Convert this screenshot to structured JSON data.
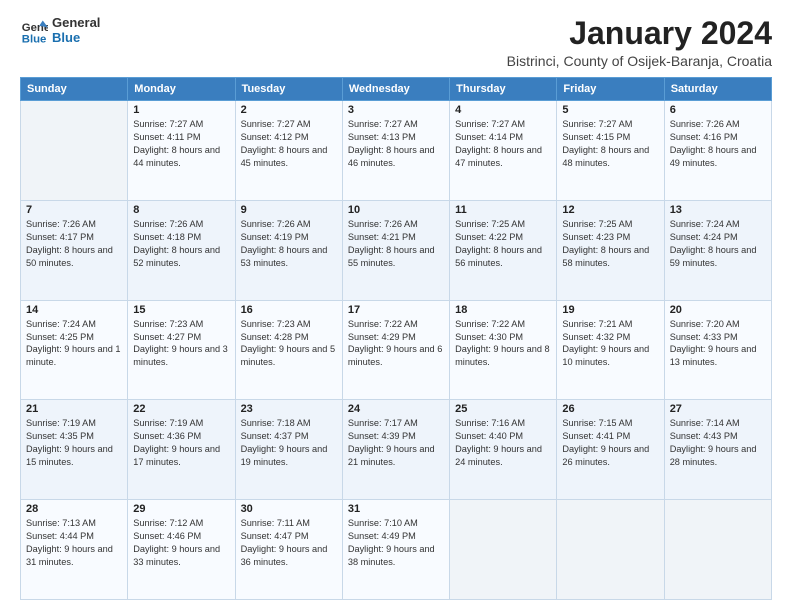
{
  "header": {
    "logo_line1": "General",
    "logo_line2": "Blue",
    "month": "January 2024",
    "location": "Bistrinci, County of Osijek-Baranja, Croatia"
  },
  "weekdays": [
    "Sunday",
    "Monday",
    "Tuesday",
    "Wednesday",
    "Thursday",
    "Friday",
    "Saturday"
  ],
  "weeks": [
    [
      {
        "day": "",
        "sunrise": "",
        "sunset": "",
        "daylight": ""
      },
      {
        "day": "1",
        "sunrise": "Sunrise: 7:27 AM",
        "sunset": "Sunset: 4:11 PM",
        "daylight": "Daylight: 8 hours and 44 minutes."
      },
      {
        "day": "2",
        "sunrise": "Sunrise: 7:27 AM",
        "sunset": "Sunset: 4:12 PM",
        "daylight": "Daylight: 8 hours and 45 minutes."
      },
      {
        "day": "3",
        "sunrise": "Sunrise: 7:27 AM",
        "sunset": "Sunset: 4:13 PM",
        "daylight": "Daylight: 8 hours and 46 minutes."
      },
      {
        "day": "4",
        "sunrise": "Sunrise: 7:27 AM",
        "sunset": "Sunset: 4:14 PM",
        "daylight": "Daylight: 8 hours and 47 minutes."
      },
      {
        "day": "5",
        "sunrise": "Sunrise: 7:27 AM",
        "sunset": "Sunset: 4:15 PM",
        "daylight": "Daylight: 8 hours and 48 minutes."
      },
      {
        "day": "6",
        "sunrise": "Sunrise: 7:26 AM",
        "sunset": "Sunset: 4:16 PM",
        "daylight": "Daylight: 8 hours and 49 minutes."
      }
    ],
    [
      {
        "day": "7",
        "sunrise": "Sunrise: 7:26 AM",
        "sunset": "Sunset: 4:17 PM",
        "daylight": "Daylight: 8 hours and 50 minutes."
      },
      {
        "day": "8",
        "sunrise": "Sunrise: 7:26 AM",
        "sunset": "Sunset: 4:18 PM",
        "daylight": "Daylight: 8 hours and 52 minutes."
      },
      {
        "day": "9",
        "sunrise": "Sunrise: 7:26 AM",
        "sunset": "Sunset: 4:19 PM",
        "daylight": "Daylight: 8 hours and 53 minutes."
      },
      {
        "day": "10",
        "sunrise": "Sunrise: 7:26 AM",
        "sunset": "Sunset: 4:21 PM",
        "daylight": "Daylight: 8 hours and 55 minutes."
      },
      {
        "day": "11",
        "sunrise": "Sunrise: 7:25 AM",
        "sunset": "Sunset: 4:22 PM",
        "daylight": "Daylight: 8 hours and 56 minutes."
      },
      {
        "day": "12",
        "sunrise": "Sunrise: 7:25 AM",
        "sunset": "Sunset: 4:23 PM",
        "daylight": "Daylight: 8 hours and 58 minutes."
      },
      {
        "day": "13",
        "sunrise": "Sunrise: 7:24 AM",
        "sunset": "Sunset: 4:24 PM",
        "daylight": "Daylight: 8 hours and 59 minutes."
      }
    ],
    [
      {
        "day": "14",
        "sunrise": "Sunrise: 7:24 AM",
        "sunset": "Sunset: 4:25 PM",
        "daylight": "Daylight: 9 hours and 1 minute."
      },
      {
        "day": "15",
        "sunrise": "Sunrise: 7:23 AM",
        "sunset": "Sunset: 4:27 PM",
        "daylight": "Daylight: 9 hours and 3 minutes."
      },
      {
        "day": "16",
        "sunrise": "Sunrise: 7:23 AM",
        "sunset": "Sunset: 4:28 PM",
        "daylight": "Daylight: 9 hours and 5 minutes."
      },
      {
        "day": "17",
        "sunrise": "Sunrise: 7:22 AM",
        "sunset": "Sunset: 4:29 PM",
        "daylight": "Daylight: 9 hours and 6 minutes."
      },
      {
        "day": "18",
        "sunrise": "Sunrise: 7:22 AM",
        "sunset": "Sunset: 4:30 PM",
        "daylight": "Daylight: 9 hours and 8 minutes."
      },
      {
        "day": "19",
        "sunrise": "Sunrise: 7:21 AM",
        "sunset": "Sunset: 4:32 PM",
        "daylight": "Daylight: 9 hours and 10 minutes."
      },
      {
        "day": "20",
        "sunrise": "Sunrise: 7:20 AM",
        "sunset": "Sunset: 4:33 PM",
        "daylight": "Daylight: 9 hours and 13 minutes."
      }
    ],
    [
      {
        "day": "21",
        "sunrise": "Sunrise: 7:19 AM",
        "sunset": "Sunset: 4:35 PM",
        "daylight": "Daylight: 9 hours and 15 minutes."
      },
      {
        "day": "22",
        "sunrise": "Sunrise: 7:19 AM",
        "sunset": "Sunset: 4:36 PM",
        "daylight": "Daylight: 9 hours and 17 minutes."
      },
      {
        "day": "23",
        "sunrise": "Sunrise: 7:18 AM",
        "sunset": "Sunset: 4:37 PM",
        "daylight": "Daylight: 9 hours and 19 minutes."
      },
      {
        "day": "24",
        "sunrise": "Sunrise: 7:17 AM",
        "sunset": "Sunset: 4:39 PM",
        "daylight": "Daylight: 9 hours and 21 minutes."
      },
      {
        "day": "25",
        "sunrise": "Sunrise: 7:16 AM",
        "sunset": "Sunset: 4:40 PM",
        "daylight": "Daylight: 9 hours and 24 minutes."
      },
      {
        "day": "26",
        "sunrise": "Sunrise: 7:15 AM",
        "sunset": "Sunset: 4:41 PM",
        "daylight": "Daylight: 9 hours and 26 minutes."
      },
      {
        "day": "27",
        "sunrise": "Sunrise: 7:14 AM",
        "sunset": "Sunset: 4:43 PM",
        "daylight": "Daylight: 9 hours and 28 minutes."
      }
    ],
    [
      {
        "day": "28",
        "sunrise": "Sunrise: 7:13 AM",
        "sunset": "Sunset: 4:44 PM",
        "daylight": "Daylight: 9 hours and 31 minutes."
      },
      {
        "day": "29",
        "sunrise": "Sunrise: 7:12 AM",
        "sunset": "Sunset: 4:46 PM",
        "daylight": "Daylight: 9 hours and 33 minutes."
      },
      {
        "day": "30",
        "sunrise": "Sunrise: 7:11 AM",
        "sunset": "Sunset: 4:47 PM",
        "daylight": "Daylight: 9 hours and 36 minutes."
      },
      {
        "day": "31",
        "sunrise": "Sunrise: 7:10 AM",
        "sunset": "Sunset: 4:49 PM",
        "daylight": "Daylight: 9 hours and 38 minutes."
      },
      {
        "day": "",
        "sunrise": "",
        "sunset": "",
        "daylight": ""
      },
      {
        "day": "",
        "sunrise": "",
        "sunset": "",
        "daylight": ""
      },
      {
        "day": "",
        "sunrise": "",
        "sunset": "",
        "daylight": ""
      }
    ]
  ]
}
